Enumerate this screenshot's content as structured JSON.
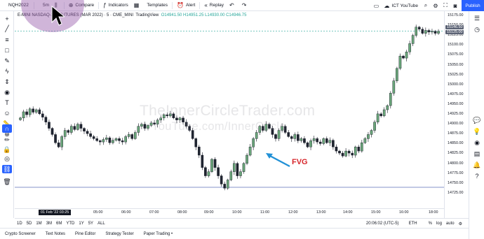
{
  "topbar": {
    "symbol": "NQH2022",
    "interval": "5m",
    "compare": "Compare",
    "indicators": "Indicators",
    "templates": "Templates",
    "alert": "Alert",
    "replay": "Replay",
    "layout_name": "ICT YouTube",
    "publish": "Publish"
  },
  "legend": {
    "name": "E-MINI NASDAQ-100 FUTURES (MAR 2022)",
    "interval": "5",
    "exchange": "CME_MINI",
    "source": "TradingView",
    "ohlc": "O14941.50 H14951.25 L14930.00 C14946.75"
  },
  "price_axis": {
    "labels": [
      "15175.00",
      "15150.00",
      "15125.00",
      "15100.00",
      "15075.00",
      "15050.00",
      "15025.00",
      "15000.00",
      "14975.00",
      "14950.00",
      "14925.00",
      "14900.00",
      "14875.00",
      "14850.00",
      "14825.00",
      "14800.00",
      "14775.00",
      "14750.00",
      "14725.00"
    ],
    "tags": [
      "15146.50",
      "15125.00"
    ]
  },
  "time_axis": {
    "labels": [
      "05:00",
      "06:00",
      "07:00",
      "08:00",
      "09:00",
      "10:00",
      "11:00",
      "12:00",
      "13:00",
      "14:00",
      "15:00",
      "16:00",
      "18:00"
    ],
    "cursor_label": "01 Feb '22  03:25"
  },
  "watermark": {
    "line1": "TheInnerCircleTrader.com",
    "line2": "YouTube.com/InnerCircle"
  },
  "annotation": {
    "label": "FVG",
    "color": "#d7262b"
  },
  "range_bar": {
    "ranges": [
      "1D",
      "5D",
      "1M",
      "3M",
      "6M",
      "YTD",
      "1Y",
      "5Y",
      "ALL"
    ],
    "time": "20:06:02 (UTC-5)",
    "session": "ETH",
    "pct": "%",
    "log": "log",
    "auto": "auto"
  },
  "bottom_tabs": [
    "Crypto Screener",
    "Text Notes",
    "Pine Editor",
    "Strategy Tester",
    "Paper Trading •"
  ],
  "colors": {
    "up": "#26a69a",
    "down": "#131722",
    "accent": "#2962ff"
  },
  "chart_data": {
    "type": "candlestick",
    "symbol": "E-MINI NASDAQ-100 FUTURES (MAR 2022)",
    "interval": "5",
    "ylim": [
      14725,
      15175
    ],
    "closes": [
      14930,
      14945,
      14938,
      14952,
      14944,
      14950,
      14940,
      14932,
      14920,
      14905,
      14890,
      14870,
      14860,
      14885,
      14900,
      14895,
      14910,
      14902,
      14915,
      14905,
      14898,
      14892,
      14885,
      14880,
      14875,
      14872,
      14878,
      14882,
      14870,
      14876,
      14880,
      14875,
      14872,
      14885,
      14890,
      14880,
      14895,
      14910,
      14915,
      14905,
      14912,
      14918,
      14915,
      14925,
      14930,
      14938,
      14935,
      14940,
      14930,
      14925,
      14930,
      14920,
      14910,
      14900,
      14880,
      14860,
      14840,
      14810,
      14790,
      14800,
      14830,
      14810,
      14790,
      14770,
      14760,
      14780,
      14800,
      14820,
      14790,
      14800,
      14820,
      14840,
      14860,
      14880,
      14895,
      14910,
      14900,
      14915,
      14905,
      14890,
      14880,
      14900,
      14910,
      14895,
      14885,
      14880,
      14890,
      14875,
      14880,
      14870,
      14860,
      14875,
      14880,
      14872,
      14868,
      14880,
      14870,
      14876,
      14860,
      14850,
      14845,
      14838,
      14850,
      14845,
      14840,
      14860,
      14850,
      14870,
      14880,
      14890,
      14900,
      14920,
      14940,
      14935,
      14950,
      14960,
      14990,
      15020,
      15050,
      15080,
      15075,
      15090,
      15110,
      15130,
      15150,
      15145,
      15135,
      15142,
      15138,
      15140,
      15135,
      15140
    ]
  }
}
